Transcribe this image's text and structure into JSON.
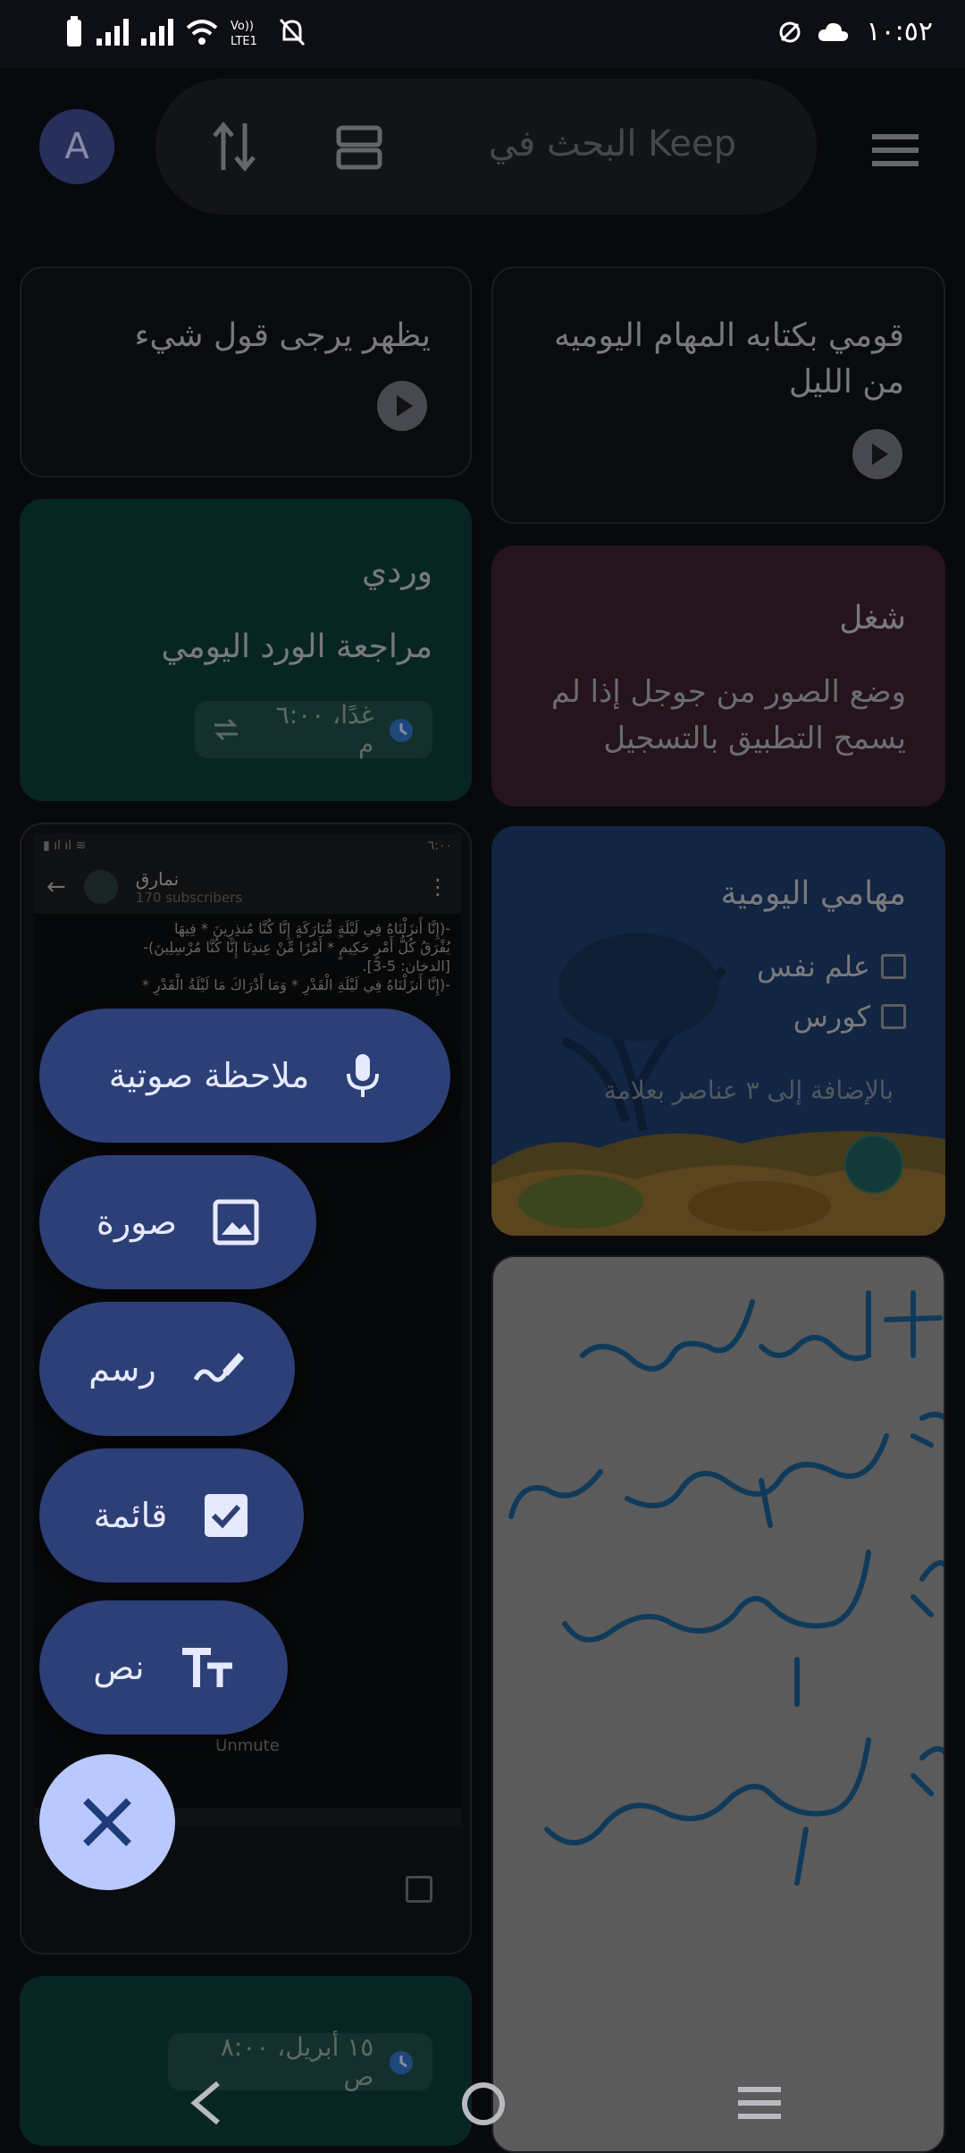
{
  "status_bar": {
    "time": "١٠:٥٢",
    "icons": [
      "battery-icon",
      "signal-icon",
      "signal-icon",
      "wifi-icon",
      "volte-icon",
      "mute-icon",
      "cloud-icon"
    ]
  },
  "search": {
    "placeholder": "البحث في Keep",
    "avatar_letter": "A"
  },
  "notes": {
    "note1": {
      "title": "قومي بكتابه المهام اليوميه من الليل"
    },
    "note2": {
      "title": "يظهر يرجى قول شيء"
    },
    "note3": {
      "title": "وردي",
      "body": "مراجعة الورد اليومي",
      "reminder": "غدًا، ٦:٠٠ م"
    },
    "note4": {
      "title": "شغل",
      "body": "وضع الصور من جوجل إذا لم يسمح التطبيق بالتسجيل"
    },
    "note5": {
      "title": "مهامي اليومية",
      "items": [
        "علم نفس",
        "كورس"
      ],
      "more": "بالإضافة إلى ٣ عناصر بعلامة"
    },
    "note6": {
      "lines": [
        "١- إنهاء الورد",
        "٢- حفظ المطلوب",
        "٣- التصوير",
        "٤- التوفو"
      ]
    },
    "note7": {
      "channel_name": "نمارق",
      "subscribers": "170 subscribers",
      "time": "٦:٠٠",
      "unmute": "Unmute",
      "text_lines": [
        "-(إِنَّا أَنزَلْنَاهُ فِي لَيْلَةٍ مُّبَارَكَةٍ إِنَّا كُنَّا مُنذِرِينَ * فِيهَا",
        "يُفْرَقُ كُلُّ أَمْرٍ حَكِيمٍ * أَمْرًا مِّنْ عِندِنَا إِنَّا كُنَّا مُرْسِلِينَ)-",
        "[الدخان: 5-3].",
        "-(إِنَّا أَنزَلْنَاهُ فِي لَيْلَةِ الْقَدْرِ * وَمَا أَدْرَاكَ مَا لَيْلَةُ الْقَدْرِ *"
      ]
    },
    "note8": {
      "reminder": "١٥ أبريل، ٨:٠٠ ص"
    }
  },
  "fab_menu": {
    "voice": "ملاحظة صوتية",
    "image": "صورة",
    "drawing": "رسم",
    "list": "قائمة",
    "text": "نص"
  },
  "colors": {
    "background": "#0d0f14",
    "green_card": "#0c3b36",
    "red_card": "#3a1f2a",
    "blue_card": "#1c3a66",
    "fab": "#2d3f77",
    "fab_close": "#b9c8ff"
  }
}
